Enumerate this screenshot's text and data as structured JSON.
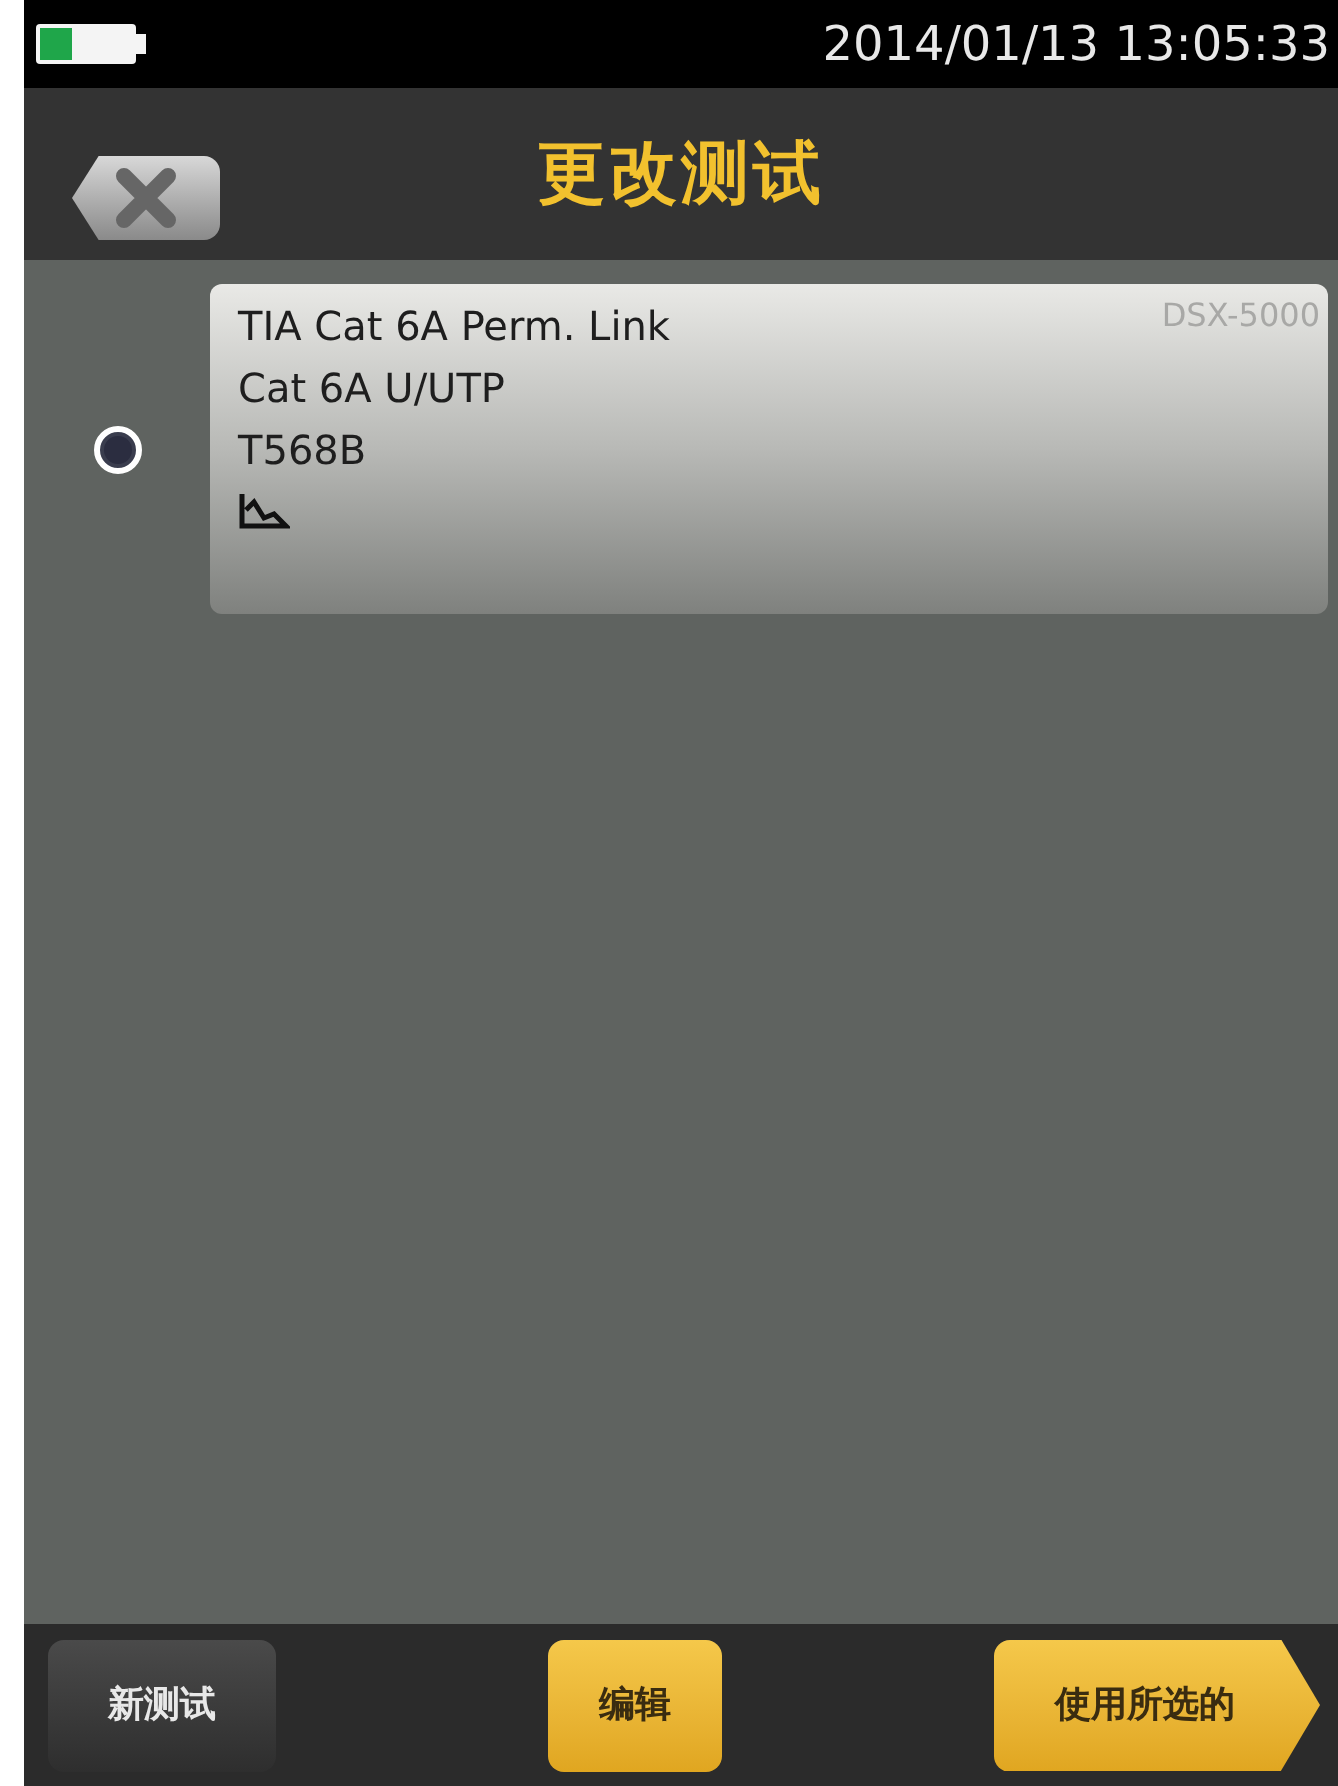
{
  "status_bar": {
    "datetime": "2014/01/13 13:05:33"
  },
  "title_bar": {
    "title": "更改测试"
  },
  "tests": [
    {
      "selected": true,
      "lines": [
        "TIA Cat 6A Perm. Link",
        "Cat 6A U/UTP",
        "T568B"
      ],
      "model": "DSX-5000",
      "graph": true
    }
  ],
  "buttons": [
    {
      "label": "新测试",
      "kind": "dark"
    },
    {
      "label": "编辑",
      "kind": "gold"
    },
    {
      "label": "使用所选的",
      "kind": "arrow"
    }
  ]
}
